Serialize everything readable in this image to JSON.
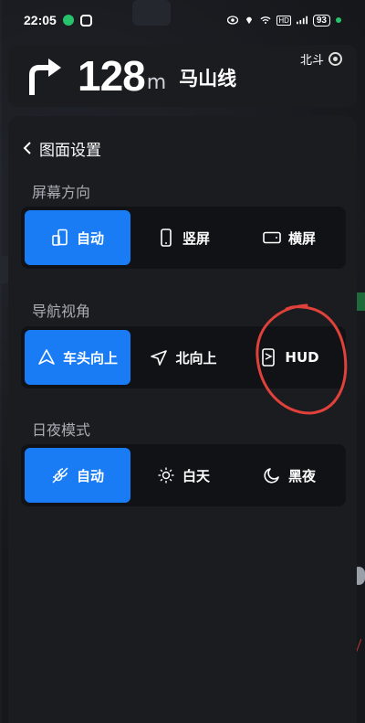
{
  "status_bar": {
    "time": "22:05",
    "network_badge": "HD",
    "battery": "93"
  },
  "nav_banner": {
    "distance": "128",
    "unit": "m",
    "road": "马山线",
    "satellite": "北斗",
    "turn_icon": "turn-right-arrow"
  },
  "panel": {
    "title": "图面设置",
    "sections": [
      {
        "label": "屏幕方向",
        "options": [
          {
            "label": "自动",
            "icon": "auto-rotate-icon",
            "active": true
          },
          {
            "label": "竖屏",
            "icon": "portrait-icon",
            "active": false
          },
          {
            "label": "横屏",
            "icon": "landscape-icon",
            "active": false
          }
        ]
      },
      {
        "label": "导航视角",
        "options": [
          {
            "label": "车头向上",
            "icon": "heading-up-icon",
            "active": true
          },
          {
            "label": "北向上",
            "icon": "north-up-icon",
            "active": false
          },
          {
            "label": "HUD",
            "icon": "hud-icon",
            "active": false
          }
        ]
      },
      {
        "label": "日夜模式",
        "options": [
          {
            "label": "自动",
            "icon": "auto-daynight-icon",
            "active": true
          },
          {
            "label": "白天",
            "icon": "sun-icon",
            "active": false
          },
          {
            "label": "黑夜",
            "icon": "moon-icon",
            "active": false
          }
        ]
      }
    ]
  },
  "colors": {
    "accent": "#1a7cf5",
    "annotation": "#e0413a"
  }
}
